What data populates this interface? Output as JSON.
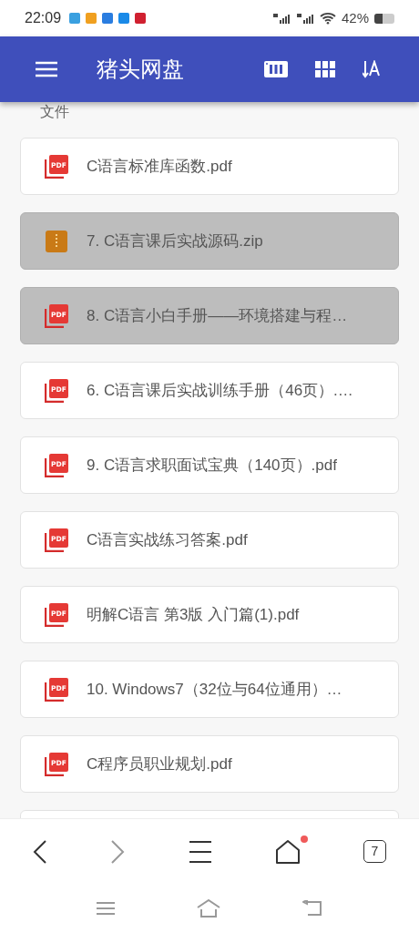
{
  "status_bar": {
    "time": "22:09",
    "battery_text": "42%"
  },
  "app_bar": {
    "title": "猪头网盘"
  },
  "section": {
    "label": "文件"
  },
  "files": [
    {
      "name": "C语言标准库函数.pdf",
      "kind": "pdf",
      "icon_text": "PDF",
      "selected": false
    },
    {
      "name": "7. C语言课后实战源码.zip",
      "kind": "zip",
      "selected": true
    },
    {
      "name": "8. C语言小白手册——环境搭建与程…",
      "kind": "pdf",
      "icon_text": "PDF",
      "selected": true
    },
    {
      "name": "6. C语言课后实战训练手册（46页）.…",
      "kind": "pdf",
      "icon_text": "PDF",
      "selected": false
    },
    {
      "name": "9. C语言求职面试宝典（140页）.pdf",
      "kind": "pdf",
      "icon_text": "PDF",
      "selected": false
    },
    {
      "name": "C语言实战练习答案.pdf",
      "kind": "pdf",
      "icon_text": "PDF",
      "selected": false
    },
    {
      "name": "明解C语言 第3版 入门篇(1).pdf",
      "kind": "pdf",
      "icon_text": "PDF",
      "selected": false
    },
    {
      "name": "10. Windows7（32位与64位通用）…",
      "kind": "pdf",
      "icon_text": "PDF",
      "selected": false
    },
    {
      "name": "C程序员职业规划.pdf",
      "kind": "pdf",
      "icon_text": "PDF",
      "selected": false
    }
  ],
  "browser_bar": {
    "tab_count": "7",
    "home_badge": true
  }
}
